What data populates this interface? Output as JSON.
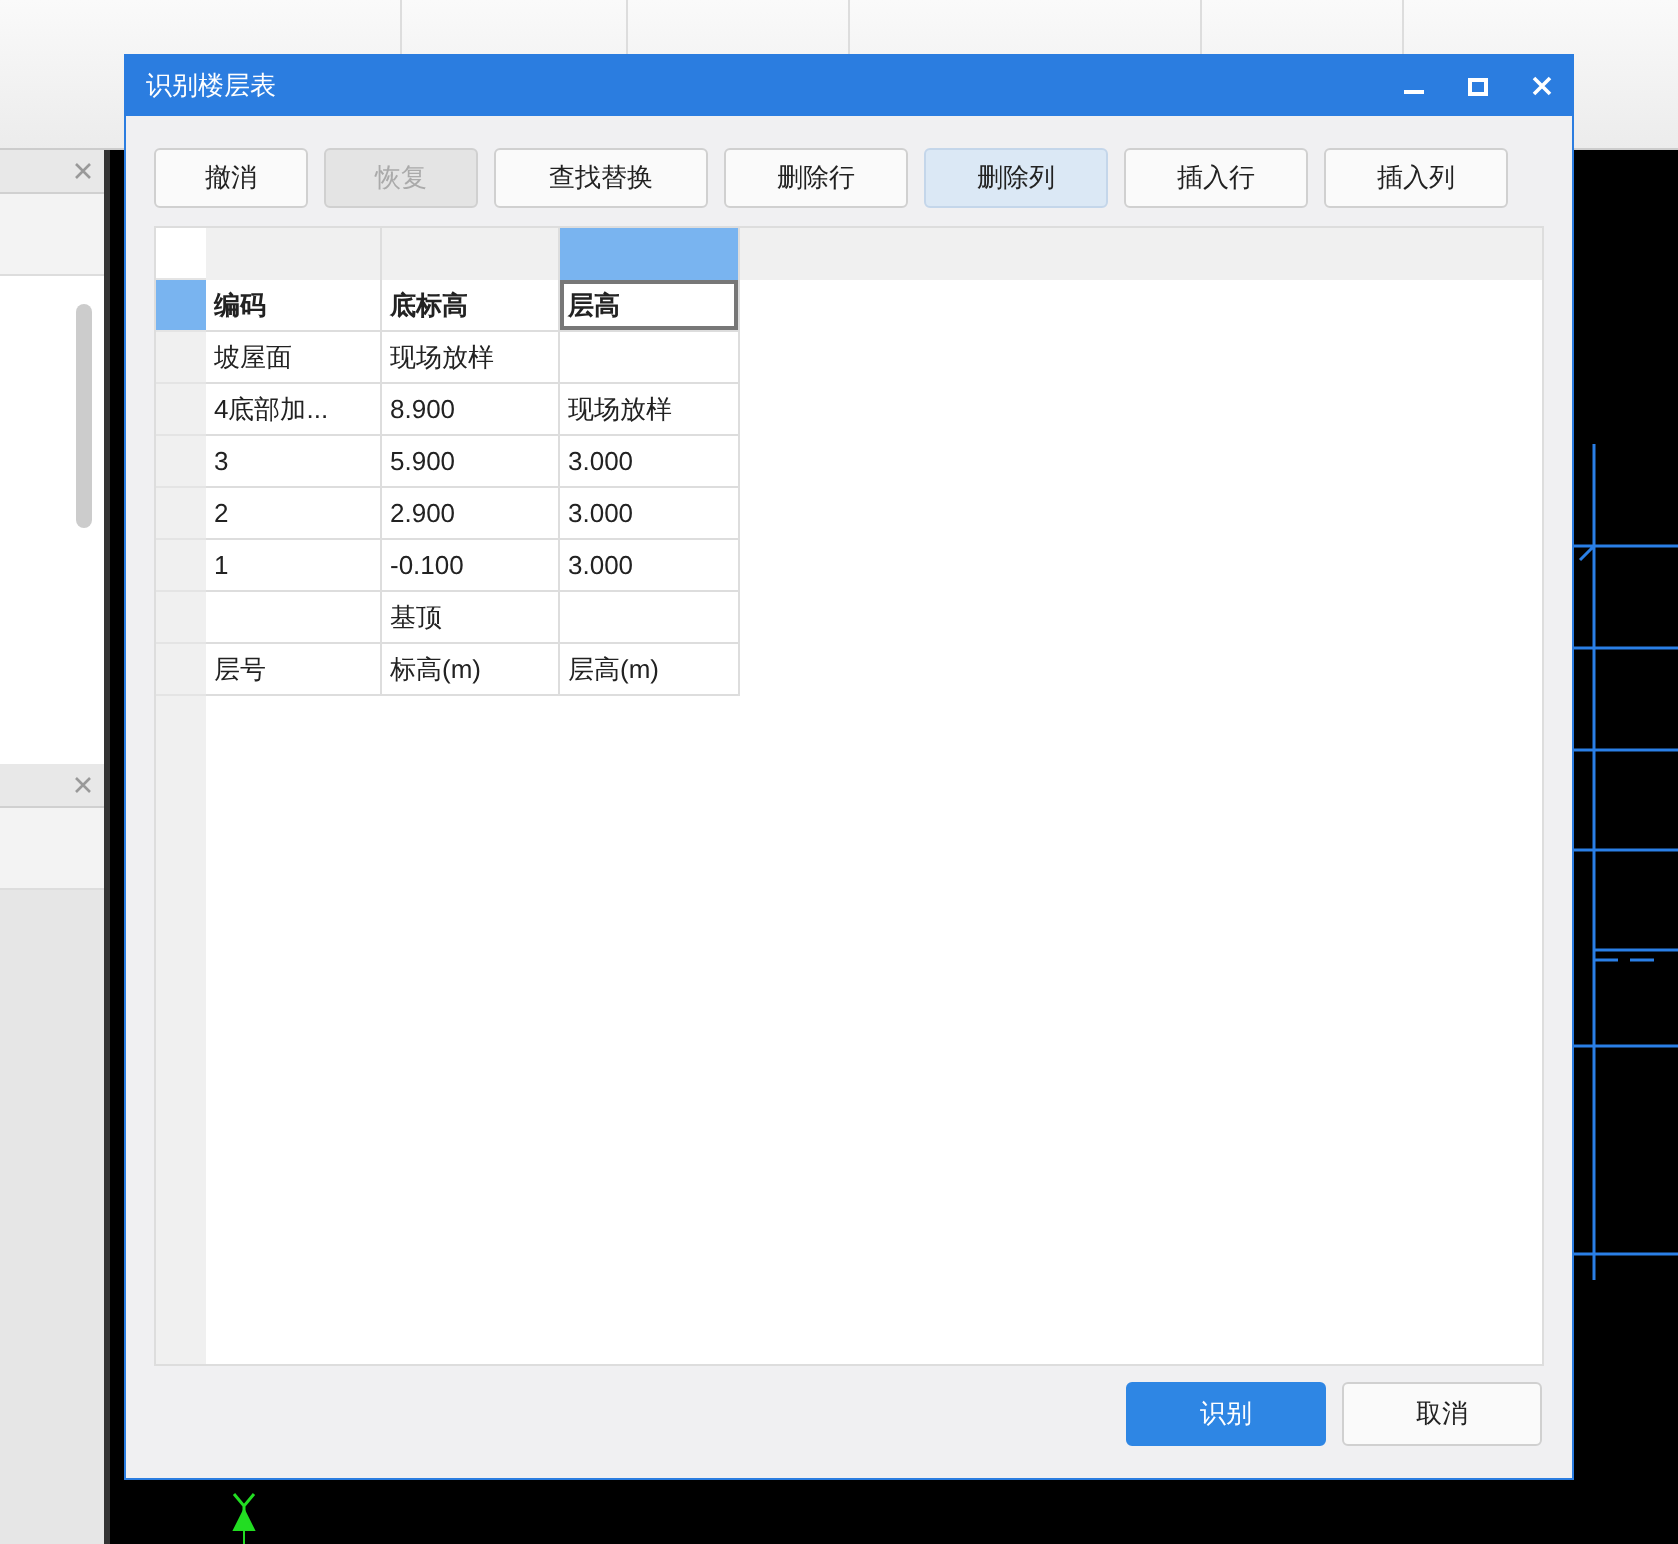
{
  "window": {
    "title": "识别楼层表"
  },
  "toolbar": [
    {
      "label": "撤消",
      "disabled": false,
      "hovered": false
    },
    {
      "label": "恢复",
      "disabled": true,
      "hovered": false
    },
    {
      "label": "查找替换",
      "disabled": false,
      "hovered": false
    },
    {
      "label": "删除行",
      "disabled": false,
      "hovered": false
    },
    {
      "label": "删除列",
      "disabled": false,
      "hovered": true
    },
    {
      "label": "插入行",
      "disabled": false,
      "hovered": false
    },
    {
      "label": "插入列",
      "disabled": false,
      "hovered": false
    }
  ],
  "table": {
    "columns": [
      {
        "selected": false
      },
      {
        "selected": false
      },
      {
        "selected": true
      }
    ],
    "rows": [
      {
        "selected": true,
        "bold": true,
        "cells": [
          "编码",
          "底标高",
          "层高"
        ]
      },
      {
        "selected": false,
        "bold": false,
        "cells": [
          "坡屋面",
          "现场放样",
          null
        ]
      },
      {
        "selected": false,
        "bold": false,
        "cells": [
          "4底部加...",
          "8.900",
          "现场放样"
        ]
      },
      {
        "selected": false,
        "bold": false,
        "cells": [
          "3",
          "5.900",
          "3.000"
        ]
      },
      {
        "selected": false,
        "bold": false,
        "cells": [
          "2",
          "2.900",
          "3.000"
        ]
      },
      {
        "selected": false,
        "bold": false,
        "cells": [
          "1",
          "-0.100",
          "3.000"
        ]
      },
      {
        "selected": false,
        "bold": false,
        "cells": [
          null,
          "基顶",
          null
        ]
      },
      {
        "selected": false,
        "bold": false,
        "cells": [
          "层号",
          "标高(m)",
          "层高(m)"
        ]
      }
    ]
  },
  "buttons": [
    {
      "label": "识别",
      "primary": true
    },
    {
      "label": "取消",
      "primary": false
    }
  ]
}
